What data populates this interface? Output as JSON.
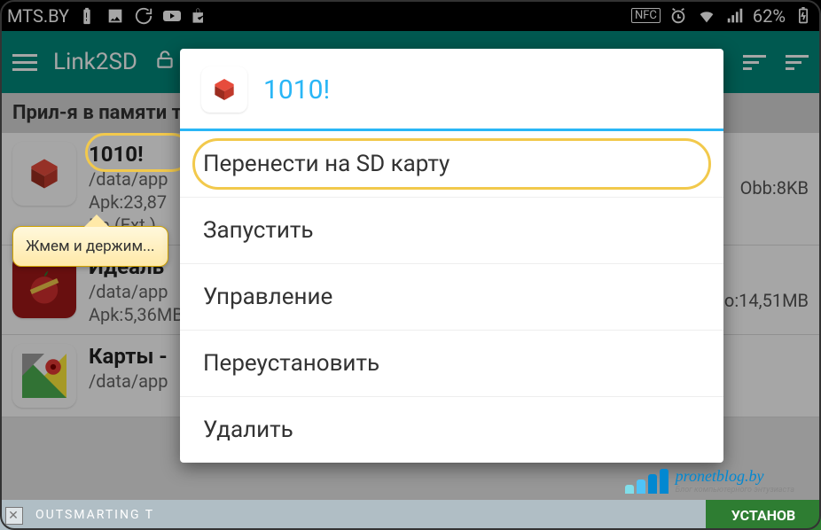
{
  "status_bar": {
    "carrier": "MTS.BY",
    "battery_text": "62%",
    "nfc": "NFC"
  },
  "app_bar": {
    "title": "Link2SD"
  },
  "section_header": "Прил-я в памяти т",
  "apps": [
    {
      "name": "1010!",
      "path": "/data/app",
      "line3": "Apk:23,87",
      "line4": "Da    (Ext.)",
      "right": "Obb:8KB"
    },
    {
      "name": "Идеаль",
      "path": "/data/app",
      "line3": "Apk:5,36MB",
      "right": "o:14,51MB"
    },
    {
      "name": "Карты -",
      "path": "/data/app",
      "line3": ""
    }
  ],
  "callout": "Жмем и держим...",
  "dialog": {
    "title": "1010!",
    "items": [
      "Перенести на SD карту",
      "Запустить",
      "Управление",
      "Переустановить",
      "Удалить"
    ]
  },
  "ad": {
    "left": "OUTSMARTING T",
    "right": "УСТАНОВ"
  },
  "watermark": {
    "site": "pronetblog.by",
    "tagline": "Блог компьютерного энтузиаста"
  }
}
